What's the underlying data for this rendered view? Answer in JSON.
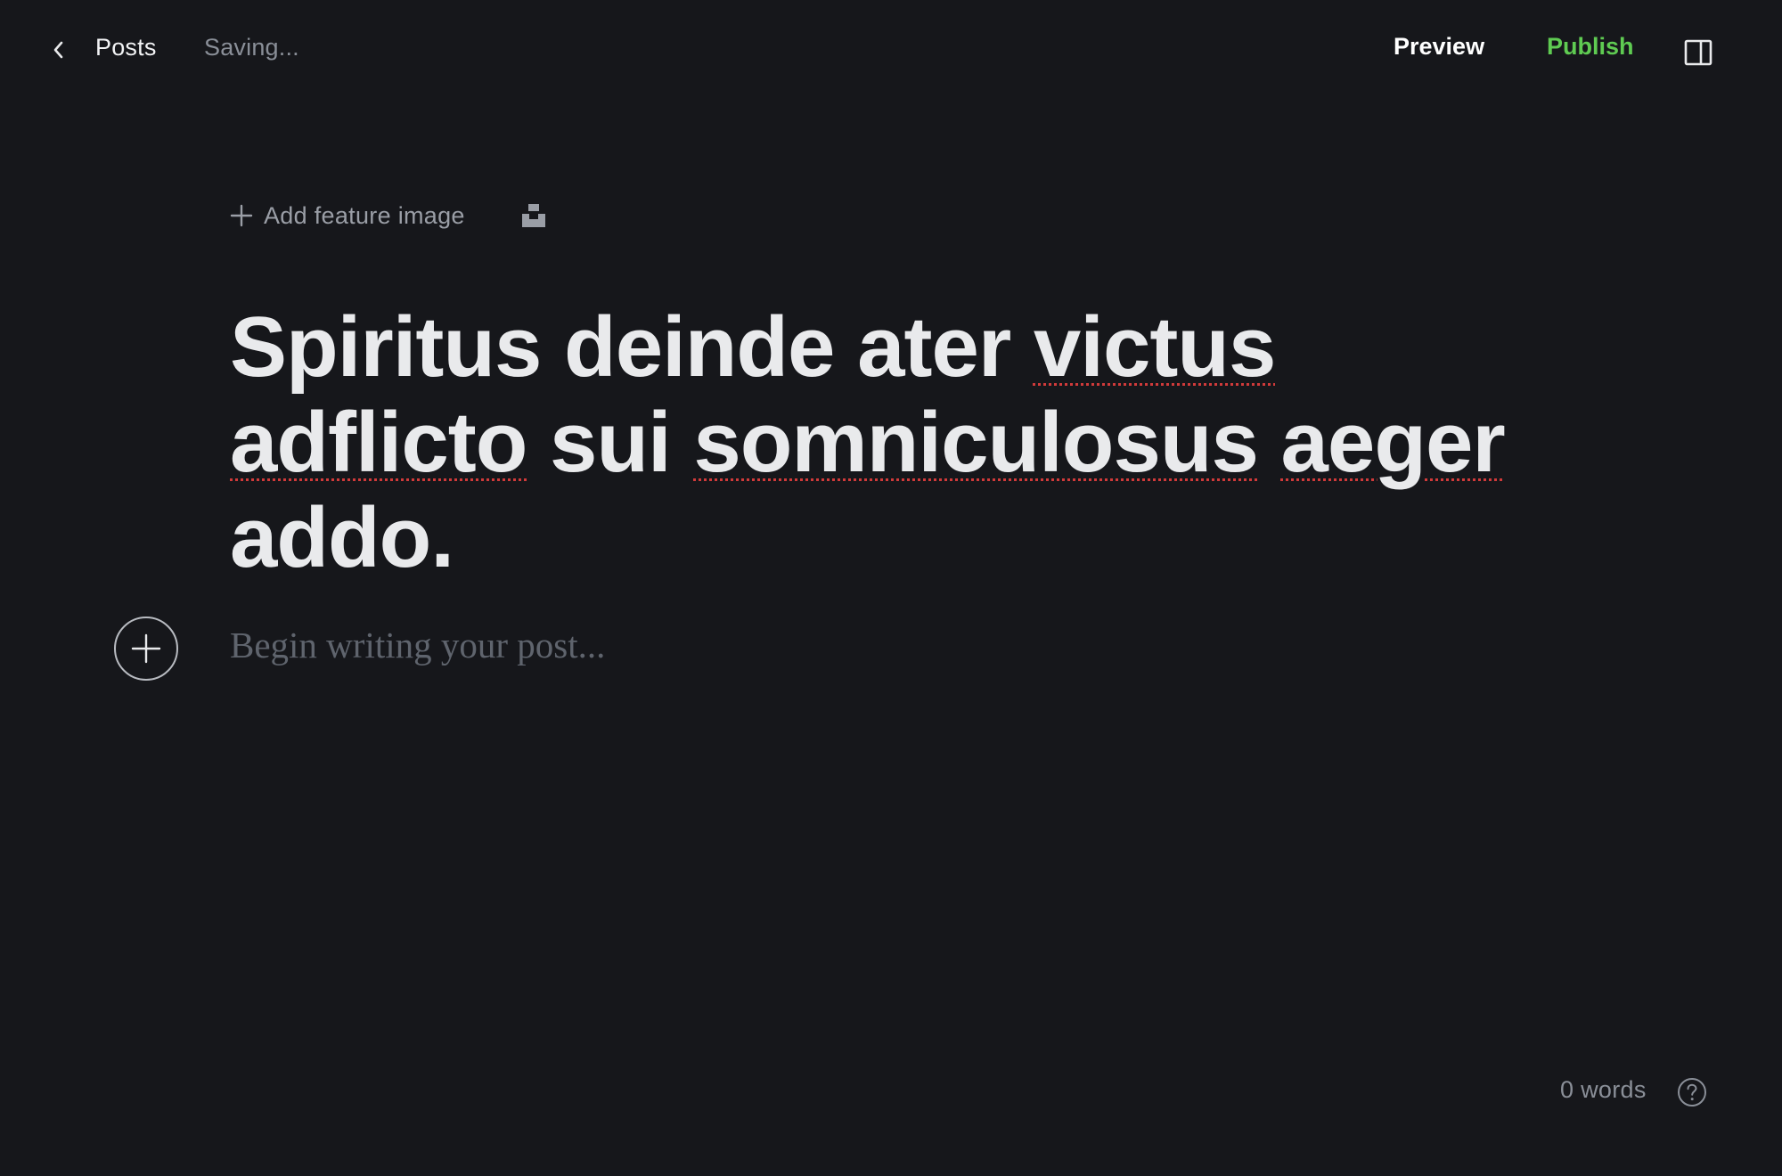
{
  "header": {
    "back_icon": "chevron-left-icon",
    "posts_label": "Posts",
    "status": "Saving...",
    "preview_label": "Preview",
    "publish_label": "Publish",
    "sidebar_icon": "sidebar-panel-icon"
  },
  "editor": {
    "feature_image_label": "Add feature image",
    "unsplash_icon": "unsplash-icon",
    "title_words": [
      "Spiritus",
      "deinde",
      "ater",
      "victus",
      "adflicto",
      "sui",
      "somniculosus",
      "aeger",
      "addo."
    ],
    "body_placeholder": "Begin writing your post...",
    "card_menu_icon": "plus-circle-icon"
  },
  "footer": {
    "word_count": "0 words",
    "help_icon": "question-circle-icon"
  },
  "colors": {
    "background": "#16171b",
    "publish": "#5fcb52",
    "spellcheck": "#d13a3a"
  }
}
